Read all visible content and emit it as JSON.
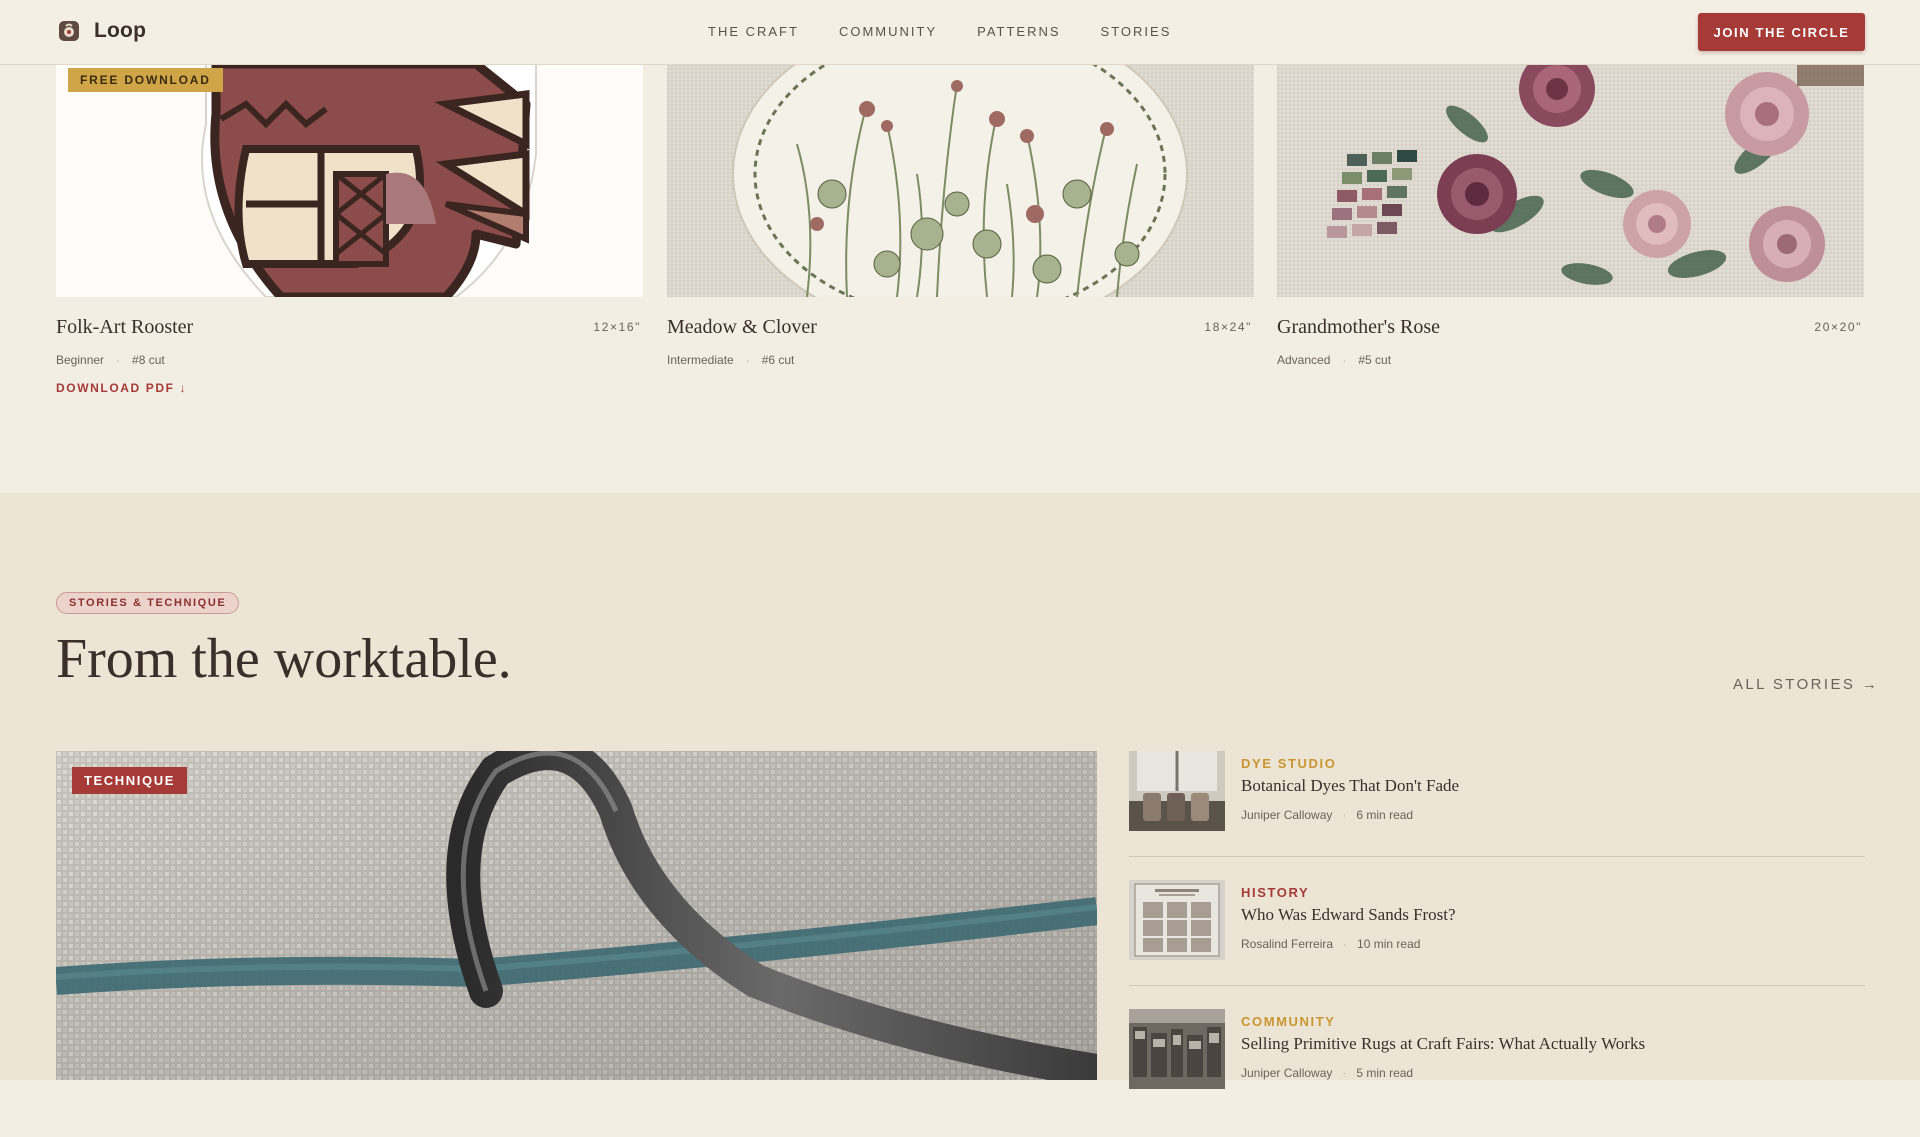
{
  "brand": {
    "name": "Loop",
    "icon": "hook-logo-icon"
  },
  "nav": {
    "items": [
      "THE CRAFT",
      "COMMUNITY",
      "PATTERNS",
      "STORIES"
    ]
  },
  "header": {
    "cta_label": "JOIN THE CIRCLE"
  },
  "colors": {
    "accent": "#a63a37",
    "gold": "#cfa547",
    "background": "#f3eee4",
    "section_bg": "#ece5d6"
  },
  "patterns": [
    {
      "badge": "FREE DOWNLOAD",
      "title": "Folk-Art Rooster",
      "size": "12×16\"",
      "level": "Beginner",
      "cut": "#8 cut",
      "link": "DOWNLOAD PDF ↓"
    },
    {
      "title": "Meadow & Clover",
      "size": "18×24\"",
      "level": "Intermediate",
      "cut": "#6 cut"
    },
    {
      "title": "Grandmother's Rose",
      "size": "20×20\"",
      "level": "Advanced",
      "cut": "#5 cut"
    }
  ],
  "stories_section": {
    "pill": "STORIES & TECHNIQUE",
    "title": "From the worktable.",
    "all_link": "ALL STORIES →",
    "feature_badge": "TECHNIQUE",
    "items": [
      {
        "category": "DYE STUDIO",
        "category_color": "#c9962f",
        "title": "Botanical Dyes That Don't Fade",
        "author": "Juniper Calloway",
        "read": "6 min read"
      },
      {
        "category": "HISTORY",
        "category_color": "#a63a37",
        "title": "Who Was Edward Sands Frost?",
        "author": "Rosalind Ferreira",
        "read": "10 min read"
      },
      {
        "category": "COMMUNITY",
        "category_color": "#c9962f",
        "title": "Selling Primitive Rugs at Craft Fairs: What Actually Works",
        "author": "Juniper Calloway",
        "read": "5 min read"
      }
    ]
  }
}
